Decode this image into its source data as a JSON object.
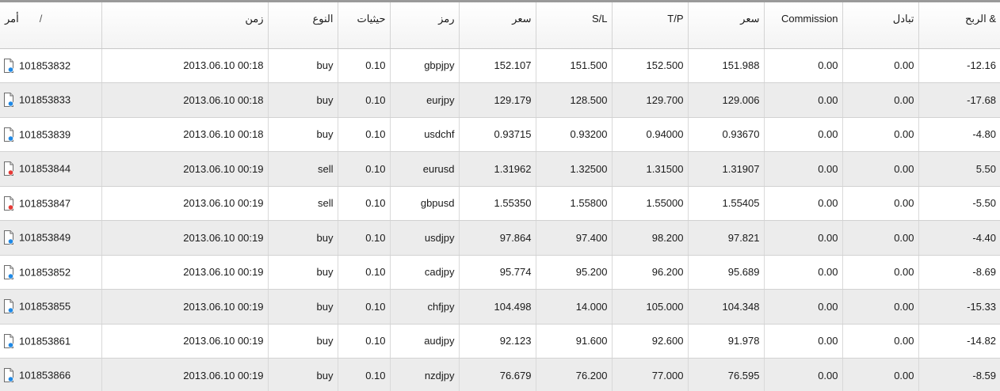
{
  "columns": {
    "order": "أمر",
    "order_sort": "/",
    "time": "زمن",
    "type": "النوع",
    "size": "حيثيات",
    "symbol": "رمز",
    "open_price": "سعر",
    "sl": "S/L",
    "tp": "T/P",
    "price": "سعر",
    "commission": "Commission",
    "swap": "تبادل",
    "profit": "الربح &"
  },
  "colors": {
    "buy_icon_dot": "#1e88e5",
    "sell_icon_dot": "#e53935",
    "alt_row": "#ececec"
  },
  "icons": {
    "buy": "buy-order-icon",
    "sell": "sell-order-icon"
  },
  "rows": [
    {
      "ticket": "101853832",
      "time": "2013.06.10 00:18",
      "type": "buy",
      "size": "0.10",
      "symbol": "gbpjpy",
      "open_price": "152.107",
      "sl": "151.500",
      "tp": "152.500",
      "price": "151.988",
      "commission": "0.00",
      "swap": "0.00",
      "profit": "-12.16"
    },
    {
      "ticket": "101853833",
      "time": "2013.06.10 00:18",
      "type": "buy",
      "size": "0.10",
      "symbol": "eurjpy",
      "open_price": "129.179",
      "sl": "128.500",
      "tp": "129.700",
      "price": "129.006",
      "commission": "0.00",
      "swap": "0.00",
      "profit": "-17.68"
    },
    {
      "ticket": "101853839",
      "time": "2013.06.10 00:18",
      "type": "buy",
      "size": "0.10",
      "symbol": "usdchf",
      "open_price": "0.93715",
      "sl": "0.93200",
      "tp": "0.94000",
      "price": "0.93670",
      "commission": "0.00",
      "swap": "0.00",
      "profit": "-4.80"
    },
    {
      "ticket": "101853844",
      "time": "2013.06.10 00:19",
      "type": "sell",
      "size": "0.10",
      "symbol": "eurusd",
      "open_price": "1.31962",
      "sl": "1.32500",
      "tp": "1.31500",
      "price": "1.31907",
      "commission": "0.00",
      "swap": "0.00",
      "profit": "5.50"
    },
    {
      "ticket": "101853847",
      "time": "2013.06.10 00:19",
      "type": "sell",
      "size": "0.10",
      "symbol": "gbpusd",
      "open_price": "1.55350",
      "sl": "1.55800",
      "tp": "1.55000",
      "price": "1.55405",
      "commission": "0.00",
      "swap": "0.00",
      "profit": "-5.50"
    },
    {
      "ticket": "101853849",
      "time": "2013.06.10 00:19",
      "type": "buy",
      "size": "0.10",
      "symbol": "usdjpy",
      "open_price": "97.864",
      "sl": "97.400",
      "tp": "98.200",
      "price": "97.821",
      "commission": "0.00",
      "swap": "0.00",
      "profit": "-4.40"
    },
    {
      "ticket": "101853852",
      "time": "2013.06.10 00:19",
      "type": "buy",
      "size": "0.10",
      "symbol": "cadjpy",
      "open_price": "95.774",
      "sl": "95.200",
      "tp": "96.200",
      "price": "95.689",
      "commission": "0.00",
      "swap": "0.00",
      "profit": "-8.69"
    },
    {
      "ticket": "101853855",
      "time": "2013.06.10 00:19",
      "type": "buy",
      "size": "0.10",
      "symbol": "chfjpy",
      "open_price": "104.498",
      "sl": "14.000",
      "tp": "105.000",
      "price": "104.348",
      "commission": "0.00",
      "swap": "0.00",
      "profit": "-15.33"
    },
    {
      "ticket": "101853861",
      "time": "2013.06.10 00:19",
      "type": "buy",
      "size": "0.10",
      "symbol": "audjpy",
      "open_price": "92.123",
      "sl": "91.600",
      "tp": "92.600",
      "price": "91.978",
      "commission": "0.00",
      "swap": "0.00",
      "profit": "-14.82"
    },
    {
      "ticket": "101853866",
      "time": "2013.06.10 00:19",
      "type": "buy",
      "size": "0.10",
      "symbol": "nzdjpy",
      "open_price": "76.679",
      "sl": "76.200",
      "tp": "77.000",
      "price": "76.595",
      "commission": "0.00",
      "swap": "0.00",
      "profit": "-8.59"
    }
  ]
}
